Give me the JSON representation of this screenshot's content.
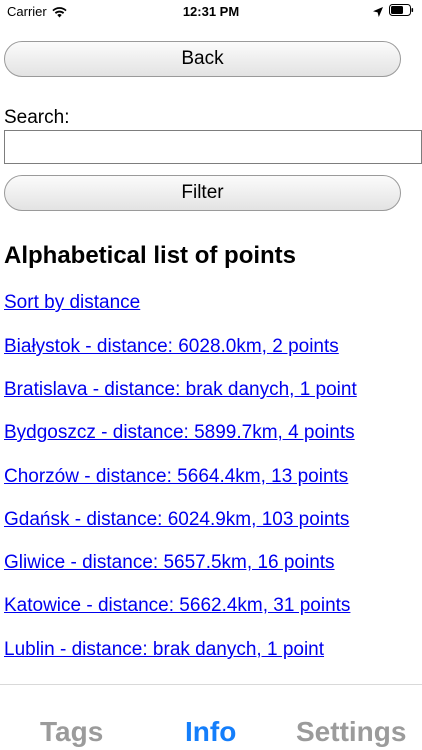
{
  "status_bar": {
    "carrier": "Carrier",
    "time": "12:31 PM"
  },
  "buttons": {
    "back": "Back",
    "filter": "Filter"
  },
  "search": {
    "label": "Search:",
    "value": "",
    "placeholder": ""
  },
  "page_title": "Alphabetical list of points",
  "sort_link": "Sort by distance",
  "points": [
    "Białystok - distance: 6028.0km, 2 points",
    "Bratislava - distance: brak danych, 1 point",
    "Bydgoszcz - distance: 5899.7km, 4 points",
    "Chorzów - distance: 5664.4km, 13 points",
    "Gdańsk - distance: 6024.9km, 103 points",
    "Gliwice - distance: 5657.5km, 16 points",
    "Katowice - distance: 5662.4km, 31 points",
    "Lublin - distance: brak danych, 1 point"
  ],
  "tabs": [
    {
      "label": "Tags",
      "active": false
    },
    {
      "label": "Info",
      "active": true
    },
    {
      "label": "Settings",
      "active": false
    }
  ],
  "colors": {
    "link": "#0000ee",
    "tab_active": "#147efb",
    "tab_inactive": "#9b9b9b"
  }
}
